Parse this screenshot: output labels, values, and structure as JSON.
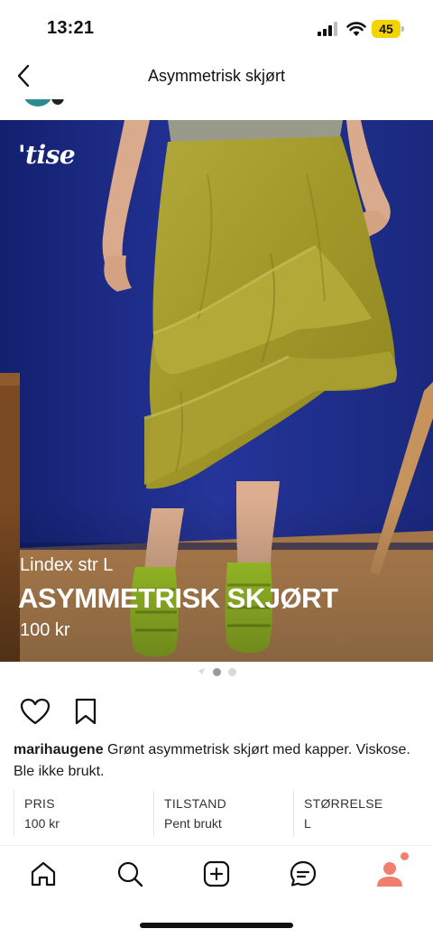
{
  "status_bar": {
    "time": "13:21",
    "battery": "45"
  },
  "header": {
    "title": "Asymmetrisk skjørt"
  },
  "photo": {
    "brand": "'tise",
    "subtitle": "Lindex str L",
    "title": "ASYMMETRISK SKJØRT",
    "price": "100 kr"
  },
  "pager": {
    "count": 2,
    "active_index": 0
  },
  "post": {
    "username": "marihaugene",
    "description": " Grønt asymmetrisk skjørt med kapper. Viskose. Ble ikke brukt."
  },
  "info": [
    {
      "label": "PRIS",
      "value": "100 kr"
    },
    {
      "label": "TILSTAND",
      "value": "Pent brukt"
    },
    {
      "label": "STØRRELSE",
      "value": "L"
    }
  ],
  "tabs": [
    {
      "name": "home",
      "icon": "home-icon"
    },
    {
      "name": "search",
      "icon": "search-icon"
    },
    {
      "name": "add",
      "icon": "plus-square-icon"
    },
    {
      "name": "messages",
      "icon": "chat-icon"
    },
    {
      "name": "profile",
      "icon": "profile-icon"
    }
  ],
  "colors": {
    "accent": "#f07f6e",
    "wall": "#1d2a8a",
    "skirt": "#a39a2c"
  }
}
